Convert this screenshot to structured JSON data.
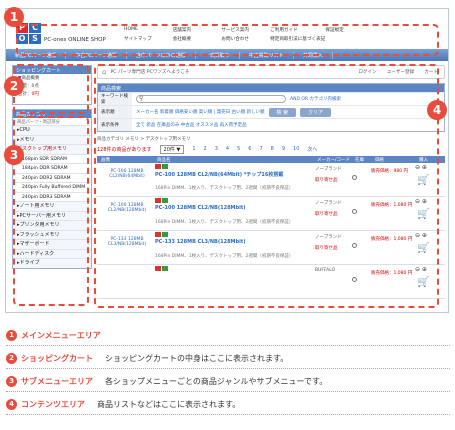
{
  "header": {
    "logo_letters": [
      "P",
      "C",
      "O",
      "S"
    ],
    "shop_name": "PC-ones ONLINE SHOP",
    "links": [
      "HOME",
      "店舗案内",
      "サービス案内",
      "ご利用ガイド",
      "保証規定",
      "サイトマップ",
      "会社概要",
      "お問い合わせ",
      "特定商取引法に基づく表記",
      ""
    ]
  },
  "nav": [
    "新品PCパーツ通販",
    "中古PCパーツ通販",
    "自作パーツ以外の通販",
    "一式買取り",
    "中古買取リスト",
    "共同購入"
  ],
  "sidebar": {
    "cart_title": "ショッピングカート",
    "cart_rows": [
      "▼商品概要",
      "数量：0点",
      "合計：",
      "0円"
    ],
    "cat_title": "商品カテゴリ",
    "cat_sub": "商品パーツ・周辺部分",
    "items": [
      {
        "label": "▸CPU",
        "type": "cat"
      },
      {
        "label": "▸メモリ",
        "type": "cat"
      },
      {
        "label": "デスクトップ用メモリ",
        "type": "active"
      },
      {
        "label": "168pin SDR SDRAM",
        "type": "sub"
      },
      {
        "label": "184pin DDR SDRAM",
        "type": "sub"
      },
      {
        "label": "240pin DDR2 SDRAM",
        "type": "sub"
      },
      {
        "label": "240pin Fully Buffered DIMM",
        "type": "sub"
      },
      {
        "label": "240pin DDR3 SDRAM",
        "type": "sub"
      },
      {
        "label": "▸ノート用メモリ",
        "type": "cat"
      },
      {
        "label": "▸PCサーバー用メモリ",
        "type": "cat"
      },
      {
        "label": "▸プリンタ用メモリ",
        "type": "cat"
      },
      {
        "label": "▸フラッシュメモリ",
        "type": "cat"
      },
      {
        "label": "▸マザーボード",
        "type": "cat"
      },
      {
        "label": "▸ハードディスク",
        "type": "cat"
      },
      {
        "label": "▸ドライブ",
        "type": "cat"
      }
    ]
  },
  "content": {
    "crumb": "PC パーツ専門店 PCワンズへようこそ",
    "crumb_right": [
      "ログイン",
      "ユーザー登録",
      "カート"
    ],
    "search_title": "商品検索",
    "kw_label": "キーワード検索",
    "kw_opts": "AND  OR  カテゴリ内検索",
    "maker_label": "表示順",
    "maker_links": "メーカー名 新着順 価格安い順 高い順 | 発売日 古い順 新しい順",
    "cond_label": "表示条件",
    "cond_links": "全て  新品  在庫品のみ  中古品  オススメ品  再入荷予定品",
    "btn_search": "検 索",
    "btn_clear": "クリア",
    "list_path": "商品カテゴリ メモリ > デスクトップ用メモリ",
    "count": "128件の商品があります",
    "per_page": "20件 ▼",
    "pages": [
      "1",
      "2",
      "3",
      "4",
      "5",
      "6",
      "7",
      "8",
      "9",
      "10",
      "次へ"
    ],
    "cols": [
      "画像",
      "商品名",
      "メーカー/コード",
      "在庫",
      "価格",
      "購入"
    ],
    "products": [
      {
        "link": "PC-100 128MB CL2/NB(64Mbit)",
        "name": "PC-100 128MB CL2/NB(64Mbit) *チップ16枚搭載",
        "desc": "168Pin DIMM、1枚入り、デスクトップ用、2週間（初期不良保証）",
        "brand": "ノーブランド",
        "stock": "取り寄せ品",
        "price": "販売価格：980 円"
      },
      {
        "link": "PC-100 128MB CL2/NB(128Mbit)",
        "name": "PC-100 128MB CL2/NB(128Mbit)",
        "desc": "168Pin DIMM、1枚入り、デスクトップ用、2週間（初期不良保証）",
        "brand": "ノーブランド",
        "stock": "取り寄せ品",
        "price": "販売価格：1,080 円"
      },
      {
        "link": "PC-133 128MB CL3/NB(128Mbit)",
        "name": "PC-133 128MB CL3/NB(128Mbit)",
        "desc": "168Pin DIMM、1枚入り、デスクトップ用、2週間（初期不良保証）",
        "brand": "ノーブランド",
        "stock": "取り寄せ品",
        "price": "販売価格：1,080 円"
      },
      {
        "link": "",
        "name": "",
        "desc": "",
        "brand": "BUFFALO",
        "stock": "",
        "price": "販売価格：1,080 円"
      }
    ]
  },
  "callouts": [
    "1",
    "2",
    "3",
    "4"
  ],
  "legend": [
    {
      "num": "1",
      "title": "メインメニューエリア",
      "desc": ""
    },
    {
      "num": "2",
      "title": "ショッピングカート",
      "desc": "ショッピングカートの中身はここに表示されます。"
    },
    {
      "num": "3",
      "title": "サブメニューエリア",
      "desc": "各ショップメニューごとの商品ジャンルやサブメニューです。"
    },
    {
      "num": "4",
      "title": "コンテンツエリア",
      "desc": "商品リストなどはここに表示されます。"
    }
  ],
  "colors": {
    "accent": "#e74c3c",
    "nav": "#5b86c3",
    "link": "#2a6cc1",
    "price": "#d40000"
  }
}
